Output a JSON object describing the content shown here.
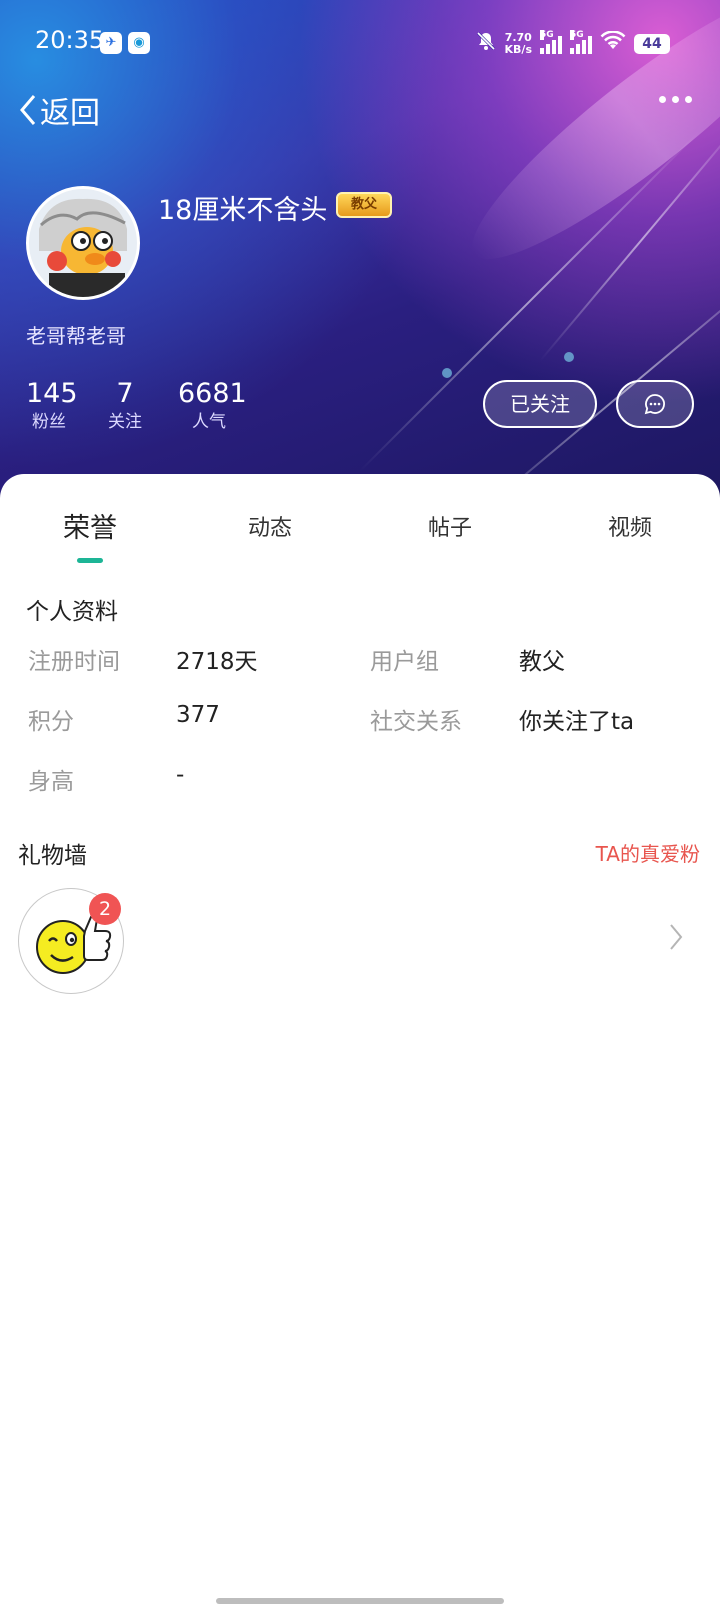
{
  "status_bar": {
    "time": "20:35",
    "net_speed_value": "7.70",
    "net_speed_unit": "KB/s",
    "signal1_label": "5G",
    "signal2_label": "5G",
    "battery": "44",
    "icons": [
      "bird-app-icon",
      "camera-app-icon",
      "mute-bell-icon",
      "wifi-icon"
    ]
  },
  "header": {
    "back_label": "返回",
    "more_icon": "more-dots-icon"
  },
  "profile": {
    "username": "18厘米不含头",
    "rank_badge": "教父",
    "bio": "老哥帮老哥",
    "stats": [
      {
        "value": "145",
        "label": "粉丝"
      },
      {
        "value": "7",
        "label": "关注"
      },
      {
        "value": "6681",
        "label": "人气"
      }
    ],
    "follow_button": "已关注",
    "message_icon": "chat-bubble-icon"
  },
  "tabs": [
    {
      "label": "荣誉",
      "active": true
    },
    {
      "label": "动态",
      "active": false
    },
    {
      "label": "帖子",
      "active": false
    },
    {
      "label": "视频",
      "active": false
    }
  ],
  "info": {
    "title": "个人资料",
    "fields": [
      {
        "label": "注册时间",
        "value": "2718天"
      },
      {
        "label": "用户组",
        "value": "教父"
      },
      {
        "label": "积分",
        "value": "377"
      },
      {
        "label": "社交关系",
        "value": "你关注了ta"
      },
      {
        "label": "身高",
        "value": "-"
      }
    ]
  },
  "gifts": {
    "title": "礼物墙",
    "link": "TA的真爱粉",
    "items": [
      {
        "icon": "thumbs-up-smiley-icon",
        "count": "2"
      }
    ]
  },
  "colors": {
    "accent": "#1db596",
    "link_red": "#e8554e",
    "badge_red": "#f05454",
    "label_gray": "#9a9a9a"
  }
}
